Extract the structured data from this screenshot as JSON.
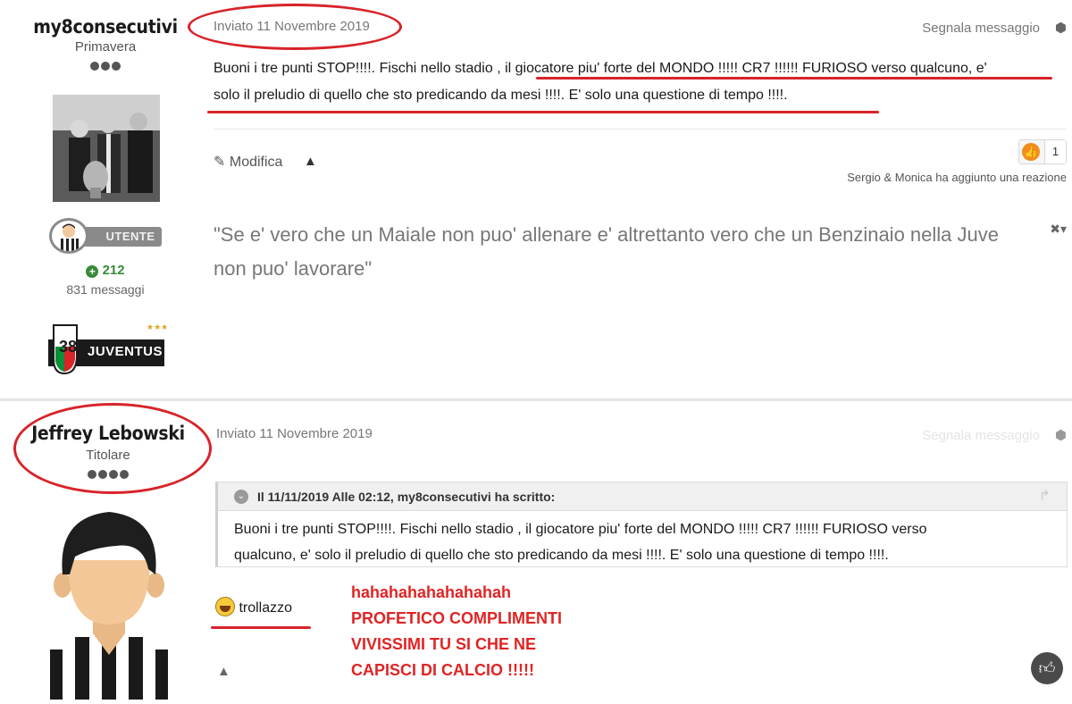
{
  "post1": {
    "author": {
      "name": "my8consecutivi",
      "rank": "Primavera",
      "badge_label": "UTENTE",
      "reputation": "212",
      "messages": "831 messaggi",
      "club_logo_number": "38",
      "club_logo_text": "JUVENTUS"
    },
    "date": "Inviato 11 Novembre 2019",
    "report": "Segnala messaggio",
    "text_line1": "Buoni i tre punti STOP!!!!. Fischi nello stadio , il giocatore piu' forte del MONDO !!!!! CR7 !!!!!! FURIOSO verso qualcuno, e'",
    "text_line2": "solo il preludio di quello che sto predicando da mesi !!!!. E' solo una questione di tempo !!!!.",
    "edit_label": "Modifica",
    "reaction_count": "1",
    "reaction_note": "Sergio & Monica ha aggiunto una reazione",
    "signature_line1": "\"Se e' vero che un Maiale non puo' allenare e' altrettanto vero che un Benzinaio nella Juve",
    "signature_line2": "non puo' lavorare\""
  },
  "post2": {
    "author": {
      "name": "Jeffrey Lebowski",
      "rank": "Titolare"
    },
    "date": "Inviato 11 Novembre 2019",
    "report": "Segnala messaggio",
    "quote_header": "Il 11/11/2019 Alle 02:12, my8consecutivi ha scritto:",
    "quote_line1": "Buoni i tre punti STOP!!!!. Fischi nello stadio , il giocatore piu' forte del MONDO !!!!! CR7 !!!!!! FURIOSO verso",
    "quote_line2": "qualcuno, e' solo il preludio di quello che sto predicando da mesi !!!!. E' solo una questione di tempo !!!!.",
    "reply_text": "trollazzo"
  },
  "annotation_text": [
    "hahahahahahahahah",
    "PROFETICO COMPLIMENTI",
    "VIVISSIMI TU SI CHE NE",
    "CAPISCI DI CALCIO !!!!!"
  ],
  "colors": {
    "annotation_red": "#d8232a",
    "reputation_green": "#3a8a3a",
    "reaction_orange": "#f28c1c"
  }
}
